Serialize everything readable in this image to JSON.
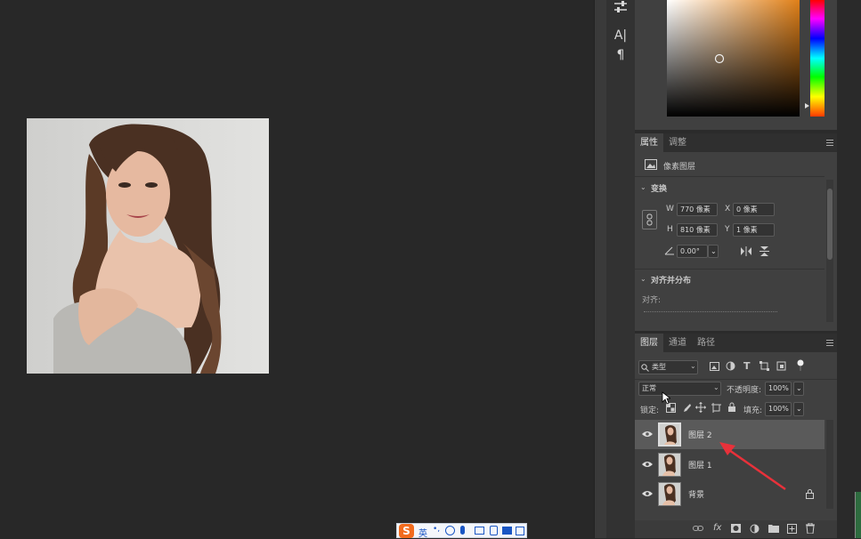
{
  "canvas": {
    "image_alt": "photo"
  },
  "tool_strip": {
    "icons": [
      "sliders-icon",
      "character-icon",
      "paragraph-icon"
    ],
    "character_glyph": "A|",
    "paragraph_glyph": "¶"
  },
  "properties_panel": {
    "tabs": [
      "属性",
      "调整"
    ],
    "layer_type": "像素图层",
    "transform_section": "变换",
    "w_label": "W",
    "w_value": "770 像素",
    "h_label": "H",
    "h_value": "810 像素",
    "x_label": "X",
    "x_value": "0 像素",
    "y_label": "Y",
    "y_value": "1 像素",
    "angle_value": "0.00°",
    "align_section": "对齐并分布",
    "align_label": "对齐:"
  },
  "layers_panel": {
    "tabs": [
      "图层",
      "通道",
      "路径"
    ],
    "filter_kind": "类型",
    "blend_mode": "正常",
    "opacity_label": "不透明度:",
    "opacity_value": "100%",
    "lock_label": "锁定:",
    "fill_label": "填充:",
    "fill_value": "100%",
    "layers": [
      {
        "name": "图层 2",
        "selected": true,
        "locked": false
      },
      {
        "name": "图层 1",
        "selected": false,
        "locked": false
      },
      {
        "name": "背景",
        "selected": false,
        "locked": true
      }
    ],
    "footer_icons": [
      "link-icon",
      "fx-icon",
      "mask-icon",
      "adjustment-icon",
      "group-icon",
      "new-layer-icon",
      "trash-icon"
    ],
    "fx_text": "fx"
  },
  "ime_bar": {
    "mode": "英"
  },
  "colors": {
    "workspace": "#282828",
    "panel": "#404040",
    "arrow": "#e8313a",
    "selected_row": "#5a5a5a"
  }
}
